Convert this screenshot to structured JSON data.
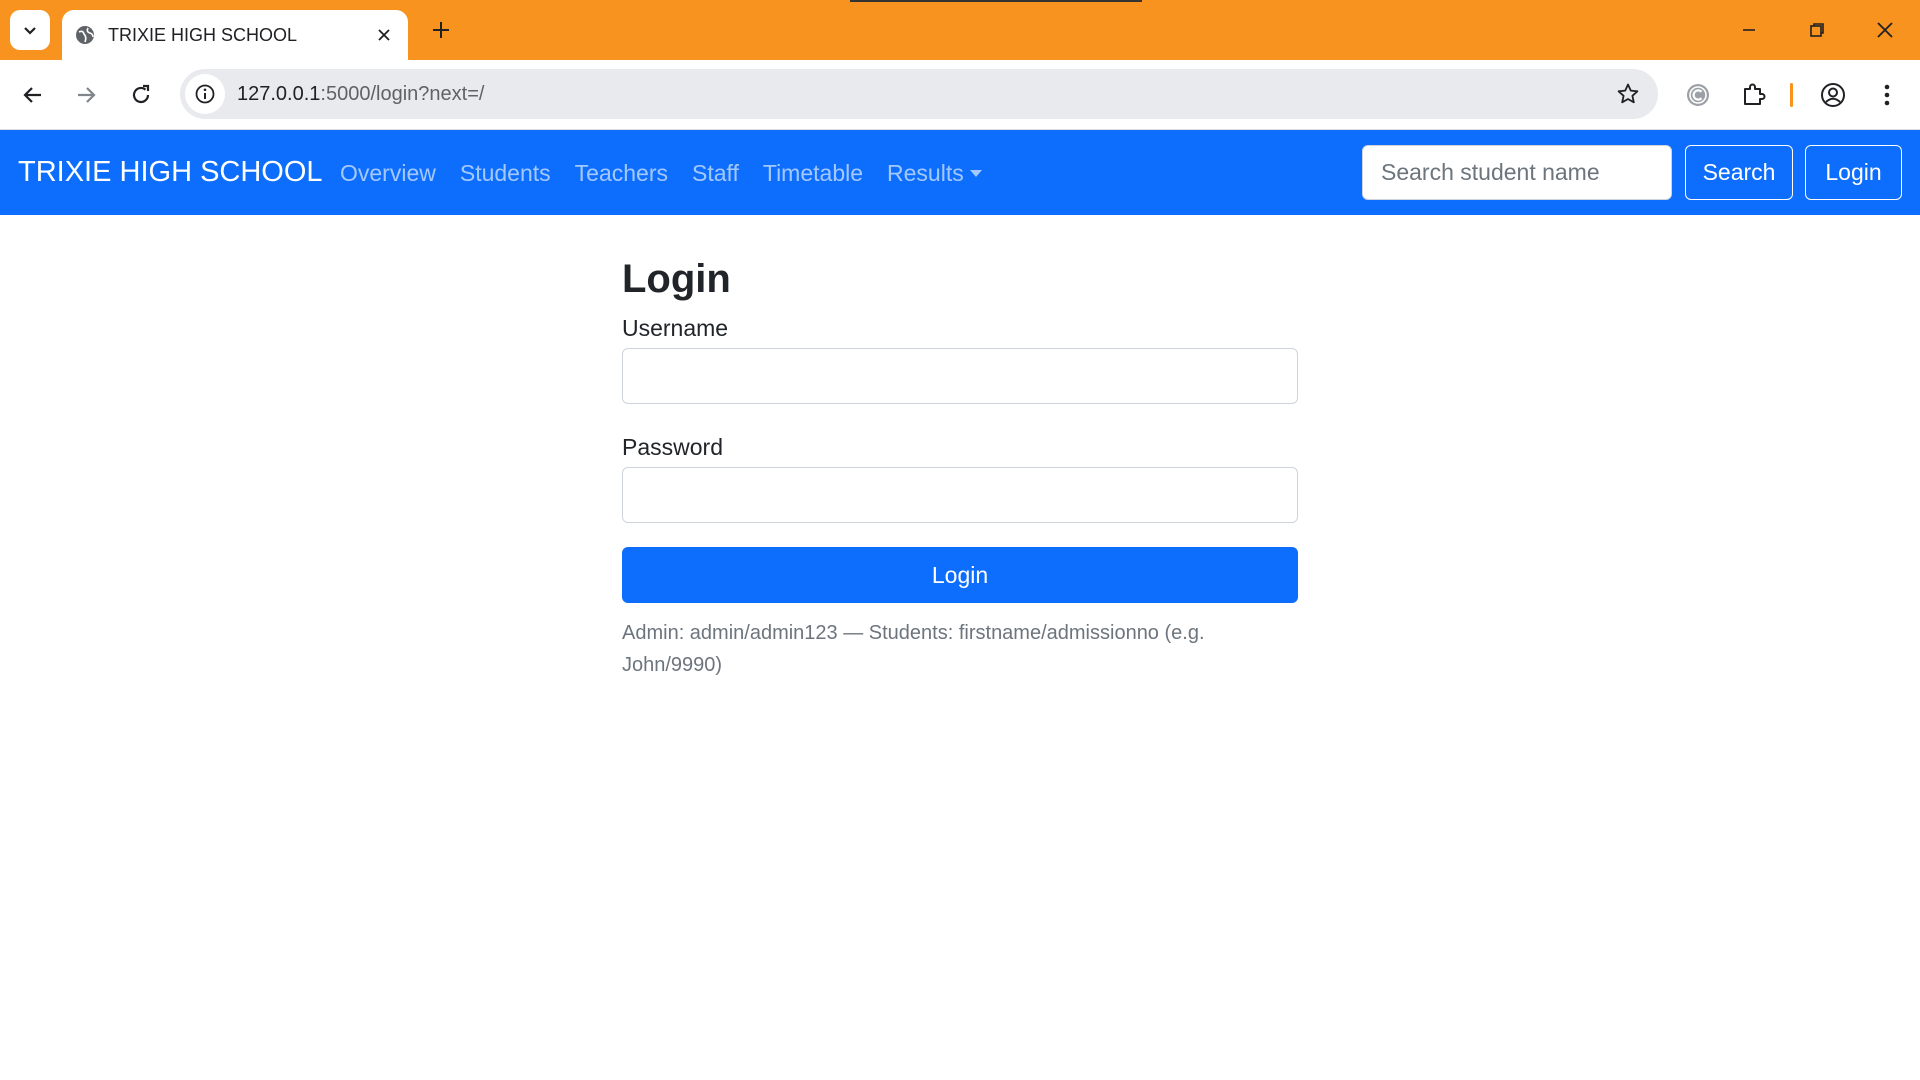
{
  "browser": {
    "tab_title": "TRIXIE HIGH SCHOOL",
    "url_host": "127.0.0.1",
    "url_rest": ":5000/login?next=/",
    "icons": [
      "tab-search-icon",
      "globe-icon",
      "close-icon",
      "plus-icon",
      "minimize-icon",
      "restore-icon",
      "back-icon",
      "forward-icon",
      "reload-icon",
      "info-icon",
      "star-icon",
      "extension-c-icon",
      "puzzle-icon",
      "profile-icon",
      "kebab-menu-icon"
    ],
    "accent_color": "#f7931e"
  },
  "navbar": {
    "brand": "TRIXIE HIGH SCHOOL",
    "links": [
      "Overview",
      "Students",
      "Teachers",
      "Staff",
      "Timetable"
    ],
    "dropdown_label": "Results",
    "search_placeholder": "Search student name",
    "search_button": "Search",
    "login_button": "Login",
    "color": "#0d6efd"
  },
  "form": {
    "title": "Login",
    "username_label": "Username",
    "username_value": "",
    "password_label": "Password",
    "password_value": "",
    "submit_label": "Login",
    "hint": "Admin: admin/admin123 — Students: firstname/admissionno (e.g. John/9990)"
  }
}
